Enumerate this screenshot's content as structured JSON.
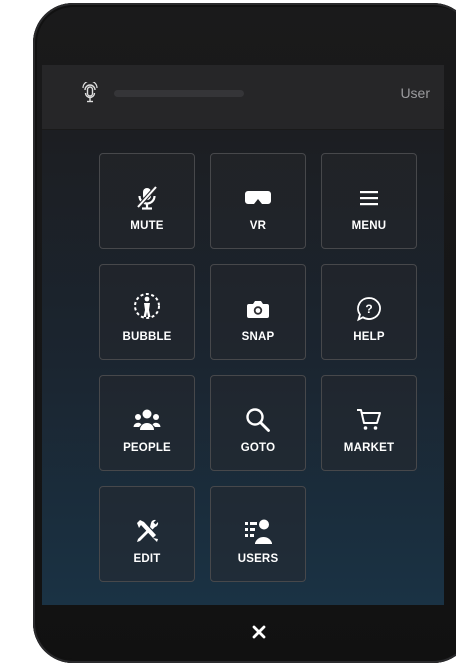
{
  "header": {
    "user_label": "User",
    "mic_level": 0
  },
  "menu": {
    "tiles": [
      {
        "label": "MUTE",
        "icon": "mic-muted-icon"
      },
      {
        "label": "VR",
        "icon": "vr-headset-icon"
      },
      {
        "label": "MENU",
        "icon": "hamburger-menu-icon"
      },
      {
        "label": "BUBBLE",
        "icon": "bubble-icon"
      },
      {
        "label": "SNAP",
        "icon": "camera-icon"
      },
      {
        "label": "HELP",
        "icon": "help-icon"
      },
      {
        "label": "PEOPLE",
        "icon": "people-icon"
      },
      {
        "label": "GOTO",
        "icon": "search-icon"
      },
      {
        "label": "MARKET",
        "icon": "cart-icon"
      },
      {
        "label": "EDIT",
        "icon": "edit-tools-icon"
      },
      {
        "label": "USERS",
        "icon": "users-list-icon"
      }
    ]
  },
  "footer": {
    "close_icon": "close-icon"
  },
  "colors": {
    "tile_border": "#47484b",
    "topbar": "#262628",
    "label": "#ffffff",
    "user_text": "#9b9b9e"
  }
}
